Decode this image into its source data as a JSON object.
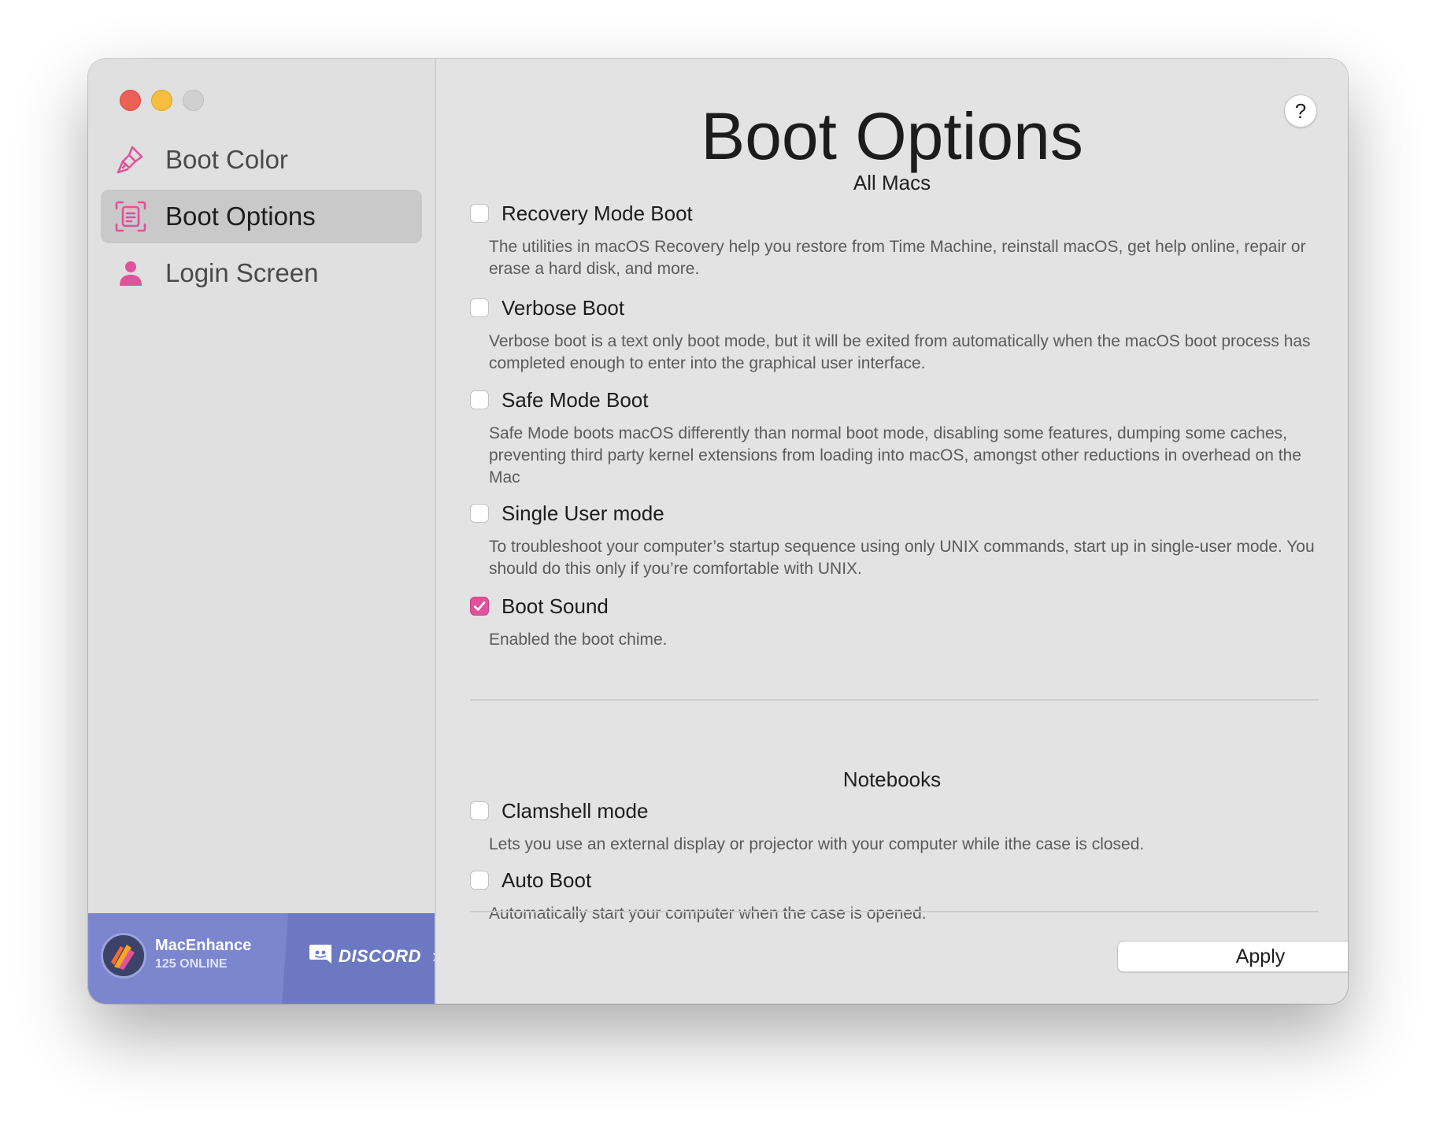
{
  "sidebar": {
    "items": [
      {
        "label": "Boot Color",
        "icon": "paintbrush-icon"
      },
      {
        "label": "Boot Options",
        "icon": "document-frame-icon",
        "active": true
      },
      {
        "label": "Login Screen",
        "icon": "person-icon"
      }
    ],
    "discord": {
      "server_name": "MacEnhance",
      "online": "125 ONLINE",
      "button_label": "DISCORD"
    }
  },
  "main": {
    "title": "Boot Options",
    "help_label": "?",
    "sections": [
      {
        "title": "All Macs",
        "options": [
          {
            "label": "Recovery Mode Boot",
            "checked": false,
            "description": "The utilities in macOS Recovery help you restore from Time Machine, reinstall macOS, get help online, repair or erase a hard disk, and more."
          },
          {
            "label": "Verbose Boot",
            "checked": false,
            "description": "Verbose boot is a text only boot mode, but it will be exited from automatically when the macOS boot process has completed enough to enter into the graphical user interface."
          },
          {
            "label": "Safe Mode Boot",
            "checked": false,
            "description": "Safe Mode boots macOS differently than normal boot mode, disabling some features, dumping some caches, preventing third party kernel extensions from loading into macOS, amongst other reductions in overhead on the Mac"
          },
          {
            "label": "Single User mode",
            "checked": false,
            "description": "To troubleshoot your computer’s startup sequence using only UNIX commands, start up in single-user mode. You should do this only if you’re comfortable with UNIX."
          },
          {
            "label": "Boot Sound",
            "checked": true,
            "description": "Enabled the boot chime."
          }
        ]
      },
      {
        "title": "Notebooks",
        "options": [
          {
            "label": "Clamshell mode",
            "checked": false,
            "description": "Lets you use an external display or projector with your computer while ithe case is closed."
          },
          {
            "label": "Auto Boot",
            "checked": false,
            "description": "Automatically start your computer when the case is opened."
          }
        ]
      }
    ],
    "apply_label": "Apply"
  },
  "colors": {
    "accent": "#e0529b",
    "discord_bg": "#7b86cf",
    "window_bg": "#e3e3e3"
  }
}
